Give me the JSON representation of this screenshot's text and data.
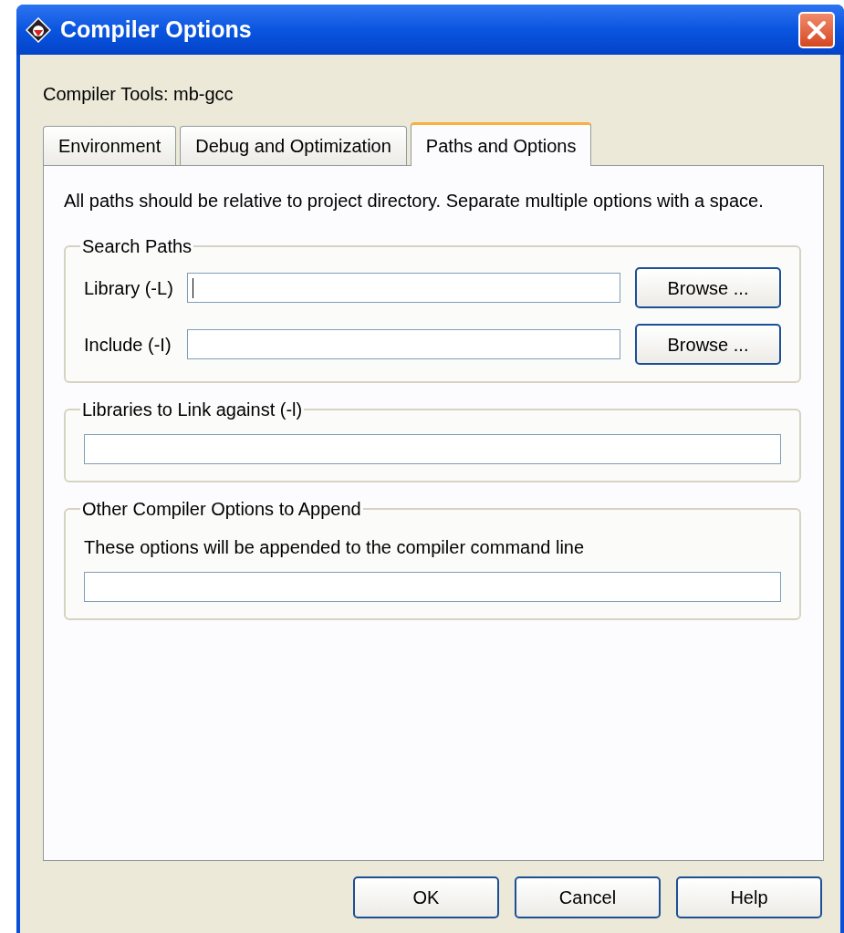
{
  "window": {
    "title": "Compiler Options"
  },
  "compiler_tools": "Compiler Tools: mb-gcc",
  "tabs": [
    {
      "label": "Environment",
      "selected": false
    },
    {
      "label": "Debug and Optimization",
      "selected": false
    },
    {
      "label": "Paths and Options",
      "selected": true
    }
  ],
  "description": "All paths should be relative to project directory. Separate multiple options with a space.",
  "groups": [
    {
      "kind": "paths",
      "title": "Search Paths",
      "rows": [
        {
          "label": "Library (-L)",
          "focused": true,
          "button": "Browse ..."
        },
        {
          "label": "Include (-I)",
          "focused": false,
          "button": "Browse ..."
        }
      ]
    },
    {
      "kind": "field",
      "title": "Libraries to Link against (-l)"
    },
    {
      "kind": "field",
      "title": "Other Compiler Options to Append",
      "note": "These options will be appended to the compiler command line"
    }
  ],
  "buttons": [
    "OK",
    "Cancel",
    "Help"
  ]
}
